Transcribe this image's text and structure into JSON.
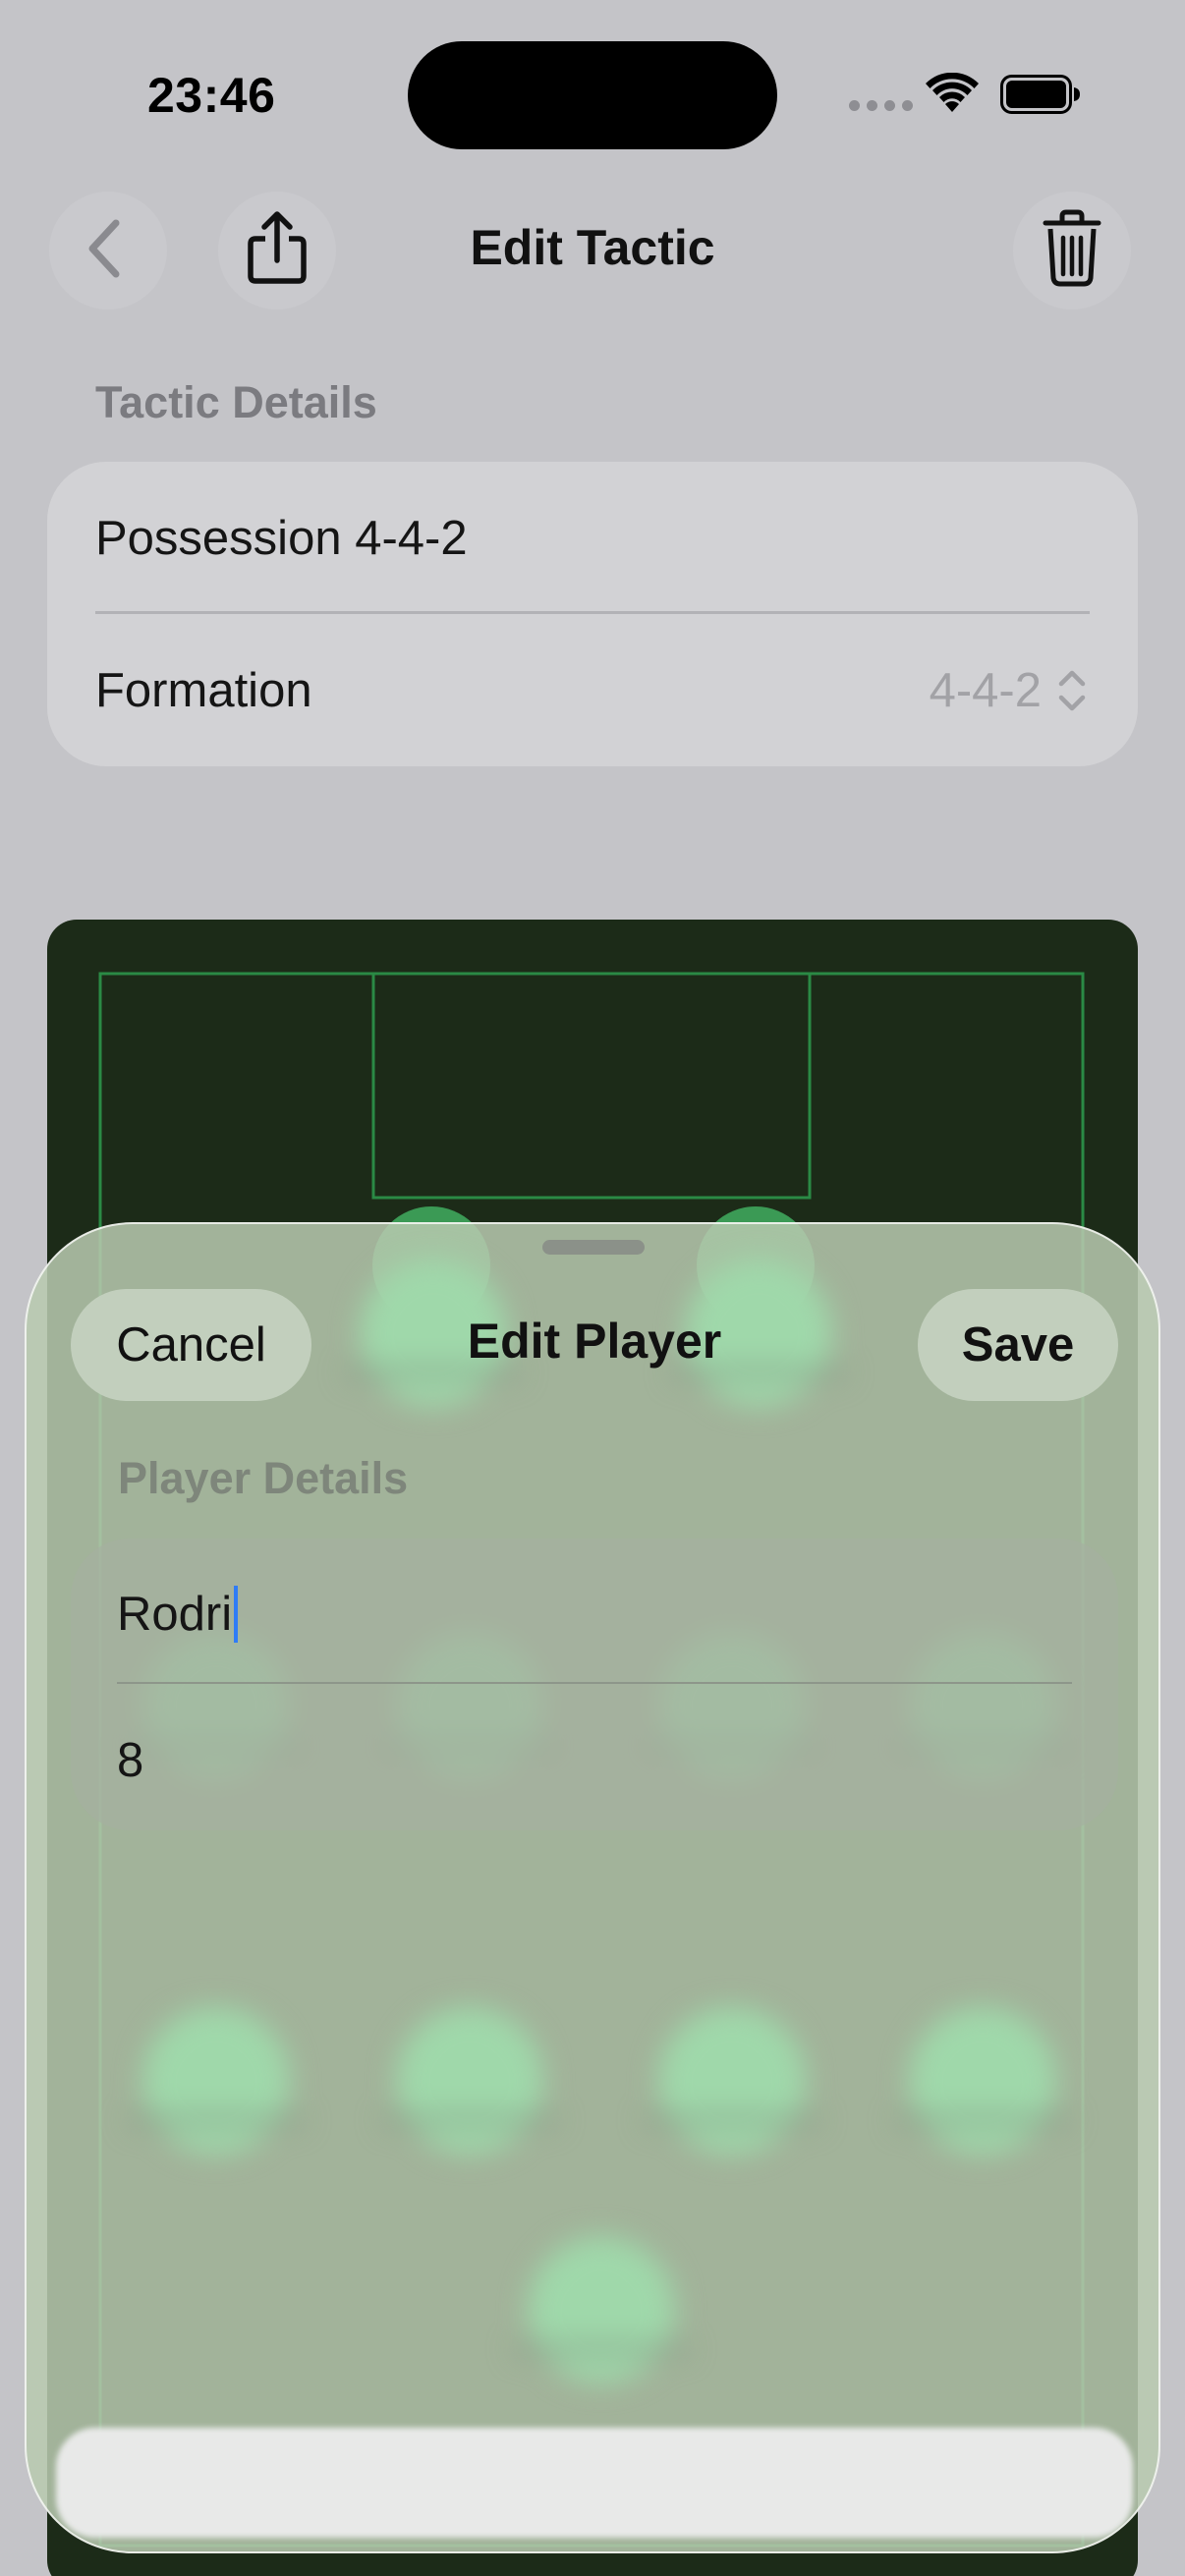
{
  "status_bar": {
    "time": "23:46",
    "icons": [
      "signal-dots-icon",
      "wifi-icon",
      "battery-icon"
    ]
  },
  "nav": {
    "title": "Edit Tactic",
    "back_icon": "chevron-left-icon",
    "share_icon": "share-icon",
    "trash_icon": "trash-icon"
  },
  "tactic_details": {
    "header": "Tactic Details",
    "name_value": "Possession 4-4-2",
    "formation_label": "Formation",
    "formation_value": "4-4-2"
  },
  "sheet": {
    "title": "Edit Player",
    "cancel_label": "Cancel",
    "save_label": "Save",
    "player_details_header": "Player Details",
    "player_name_value": "Rodri",
    "player_number_value": "8"
  },
  "colors": {
    "pitch": "#1c2b18",
    "pitch_lines": "#2a8a45",
    "player_marker": "#9fd8aa",
    "caret": "#2f7cf6"
  }
}
